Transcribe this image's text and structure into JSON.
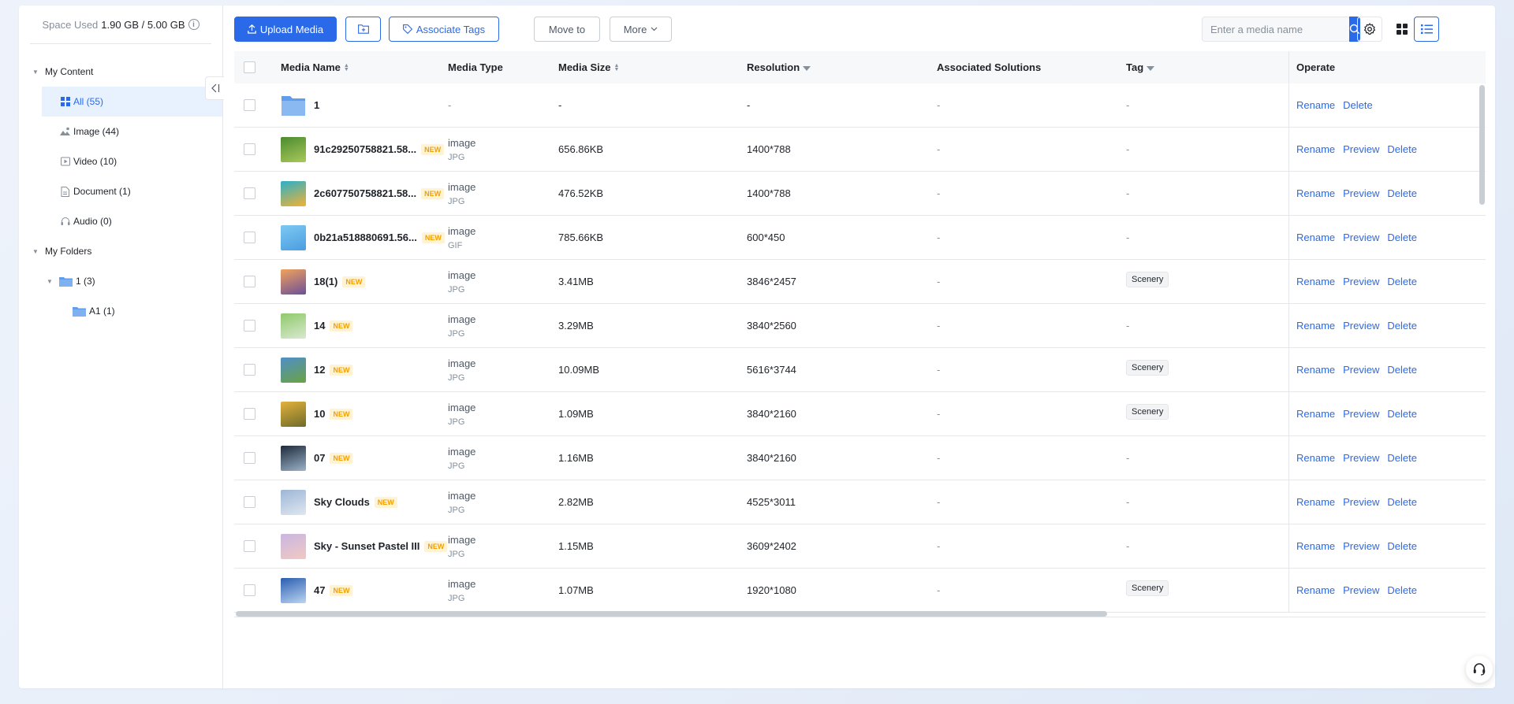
{
  "sidebar": {
    "space_label": "Space Used",
    "space_value": "1.90 GB / 5.00 GB",
    "my_content": "My Content",
    "content_items": [
      {
        "label": "All (55)",
        "icon": "grid-icon"
      },
      {
        "label": "Image (44)",
        "icon": "image-icon"
      },
      {
        "label": "Video (10)",
        "icon": "video-icon"
      },
      {
        "label": "Document (1)",
        "icon": "document-icon"
      },
      {
        "label": "Audio (0)",
        "icon": "audio-icon"
      }
    ],
    "my_folders": "My Folders",
    "folders": [
      {
        "label": "1 (3)"
      },
      {
        "label": "A1 (1)"
      }
    ]
  },
  "toolbar": {
    "upload": "Upload Media",
    "associate_tags": "Associate Tags",
    "move_to": "Move to",
    "more": "More",
    "search_placeholder": "Enter a media name"
  },
  "table": {
    "headers": {
      "name": "Media Name",
      "type": "Media Type",
      "size": "Media Size",
      "resolution": "Resolution",
      "solutions": "Associated Solutions",
      "tag": "Tag",
      "operate": "Operate"
    },
    "badge": "NEW",
    "actions": {
      "rename": "Rename",
      "preview": "Preview",
      "delete": "Delete"
    },
    "rows": [
      {
        "name": "1",
        "folder": true,
        "type": "-",
        "sub": "",
        "size": "-",
        "res": "-",
        "sol": "-",
        "tag": "-",
        "thumb": [
          "#8ab8f0",
          "#5f9ded"
        ]
      },
      {
        "name": "91c29250758821.58...",
        "new": true,
        "type": "image",
        "sub": "JPG",
        "size": "656.86KB",
        "res": "1400*788",
        "sol": "-",
        "tag": "-",
        "thumb": [
          "#4c8b2f",
          "#a9c95a"
        ]
      },
      {
        "name": "2c607750758821.58...",
        "new": true,
        "type": "image",
        "sub": "JPG",
        "size": "476.52KB",
        "res": "1400*788",
        "sol": "-",
        "tag": "-",
        "thumb": [
          "#2bb0c9",
          "#f2b233"
        ]
      },
      {
        "name": "0b21a518880691.56...",
        "new": true,
        "type": "image",
        "sub": "GIF",
        "size": "785.66KB",
        "res": "600*450",
        "sol": "-",
        "tag": "-",
        "thumb": [
          "#7ec8f2",
          "#4a9de0"
        ]
      },
      {
        "name": "18(1)",
        "new": true,
        "type": "image",
        "sub": "JPG",
        "size": "3.41MB",
        "res": "3846*2457",
        "sol": "-",
        "tag": "Scenery",
        "thumb": [
          "#f1a25b",
          "#6b4f9a"
        ]
      },
      {
        "name": "14",
        "new": true,
        "type": "image",
        "sub": "JPG",
        "size": "3.29MB",
        "res": "3840*2560",
        "sol": "-",
        "tag": "-",
        "thumb": [
          "#8fc96b",
          "#d9e9d0"
        ]
      },
      {
        "name": "12",
        "new": true,
        "type": "image",
        "sub": "JPG",
        "size": "10.09MB",
        "res": "5616*3744",
        "sol": "-",
        "tag": "Scenery",
        "thumb": [
          "#4f8ec9",
          "#6aa342"
        ]
      },
      {
        "name": "10",
        "new": true,
        "type": "image",
        "sub": "JPG",
        "size": "1.09MB",
        "res": "3840*2160",
        "sol": "-",
        "tag": "Scenery",
        "thumb": [
          "#e3b23c",
          "#6e6a2a"
        ]
      },
      {
        "name": "07",
        "new": true,
        "type": "image",
        "sub": "JPG",
        "size": "1.16MB",
        "res": "3840*2160",
        "sol": "-",
        "tag": "-",
        "thumb": [
          "#1d2a3a",
          "#9cb3c9"
        ]
      },
      {
        "name": "Sky Clouds",
        "new": true,
        "type": "image",
        "sub": "JPG",
        "size": "2.82MB",
        "res": "4525*3011",
        "sol": "-",
        "tag": "-",
        "thumb": [
          "#9db6d6",
          "#dfe7f1"
        ]
      },
      {
        "name": "Sky - Sunset Pastel III",
        "new": true,
        "type": "image",
        "sub": "JPG",
        "size": "1.15MB",
        "res": "3609*2402",
        "sol": "-",
        "tag": "-",
        "thumb": [
          "#c9b6e2",
          "#f2c9c2"
        ]
      },
      {
        "name": "47",
        "new": true,
        "type": "image",
        "sub": "JPG",
        "size": "1.07MB",
        "res": "1920*1080",
        "sol": "-",
        "tag": "Scenery",
        "thumb": [
          "#2a5db0",
          "#bcd6f2"
        ]
      }
    ]
  },
  "colors": {
    "accent": "#2a6ae9",
    "badge_bg": "#fff3d6",
    "badge_fg": "#f2a000"
  }
}
